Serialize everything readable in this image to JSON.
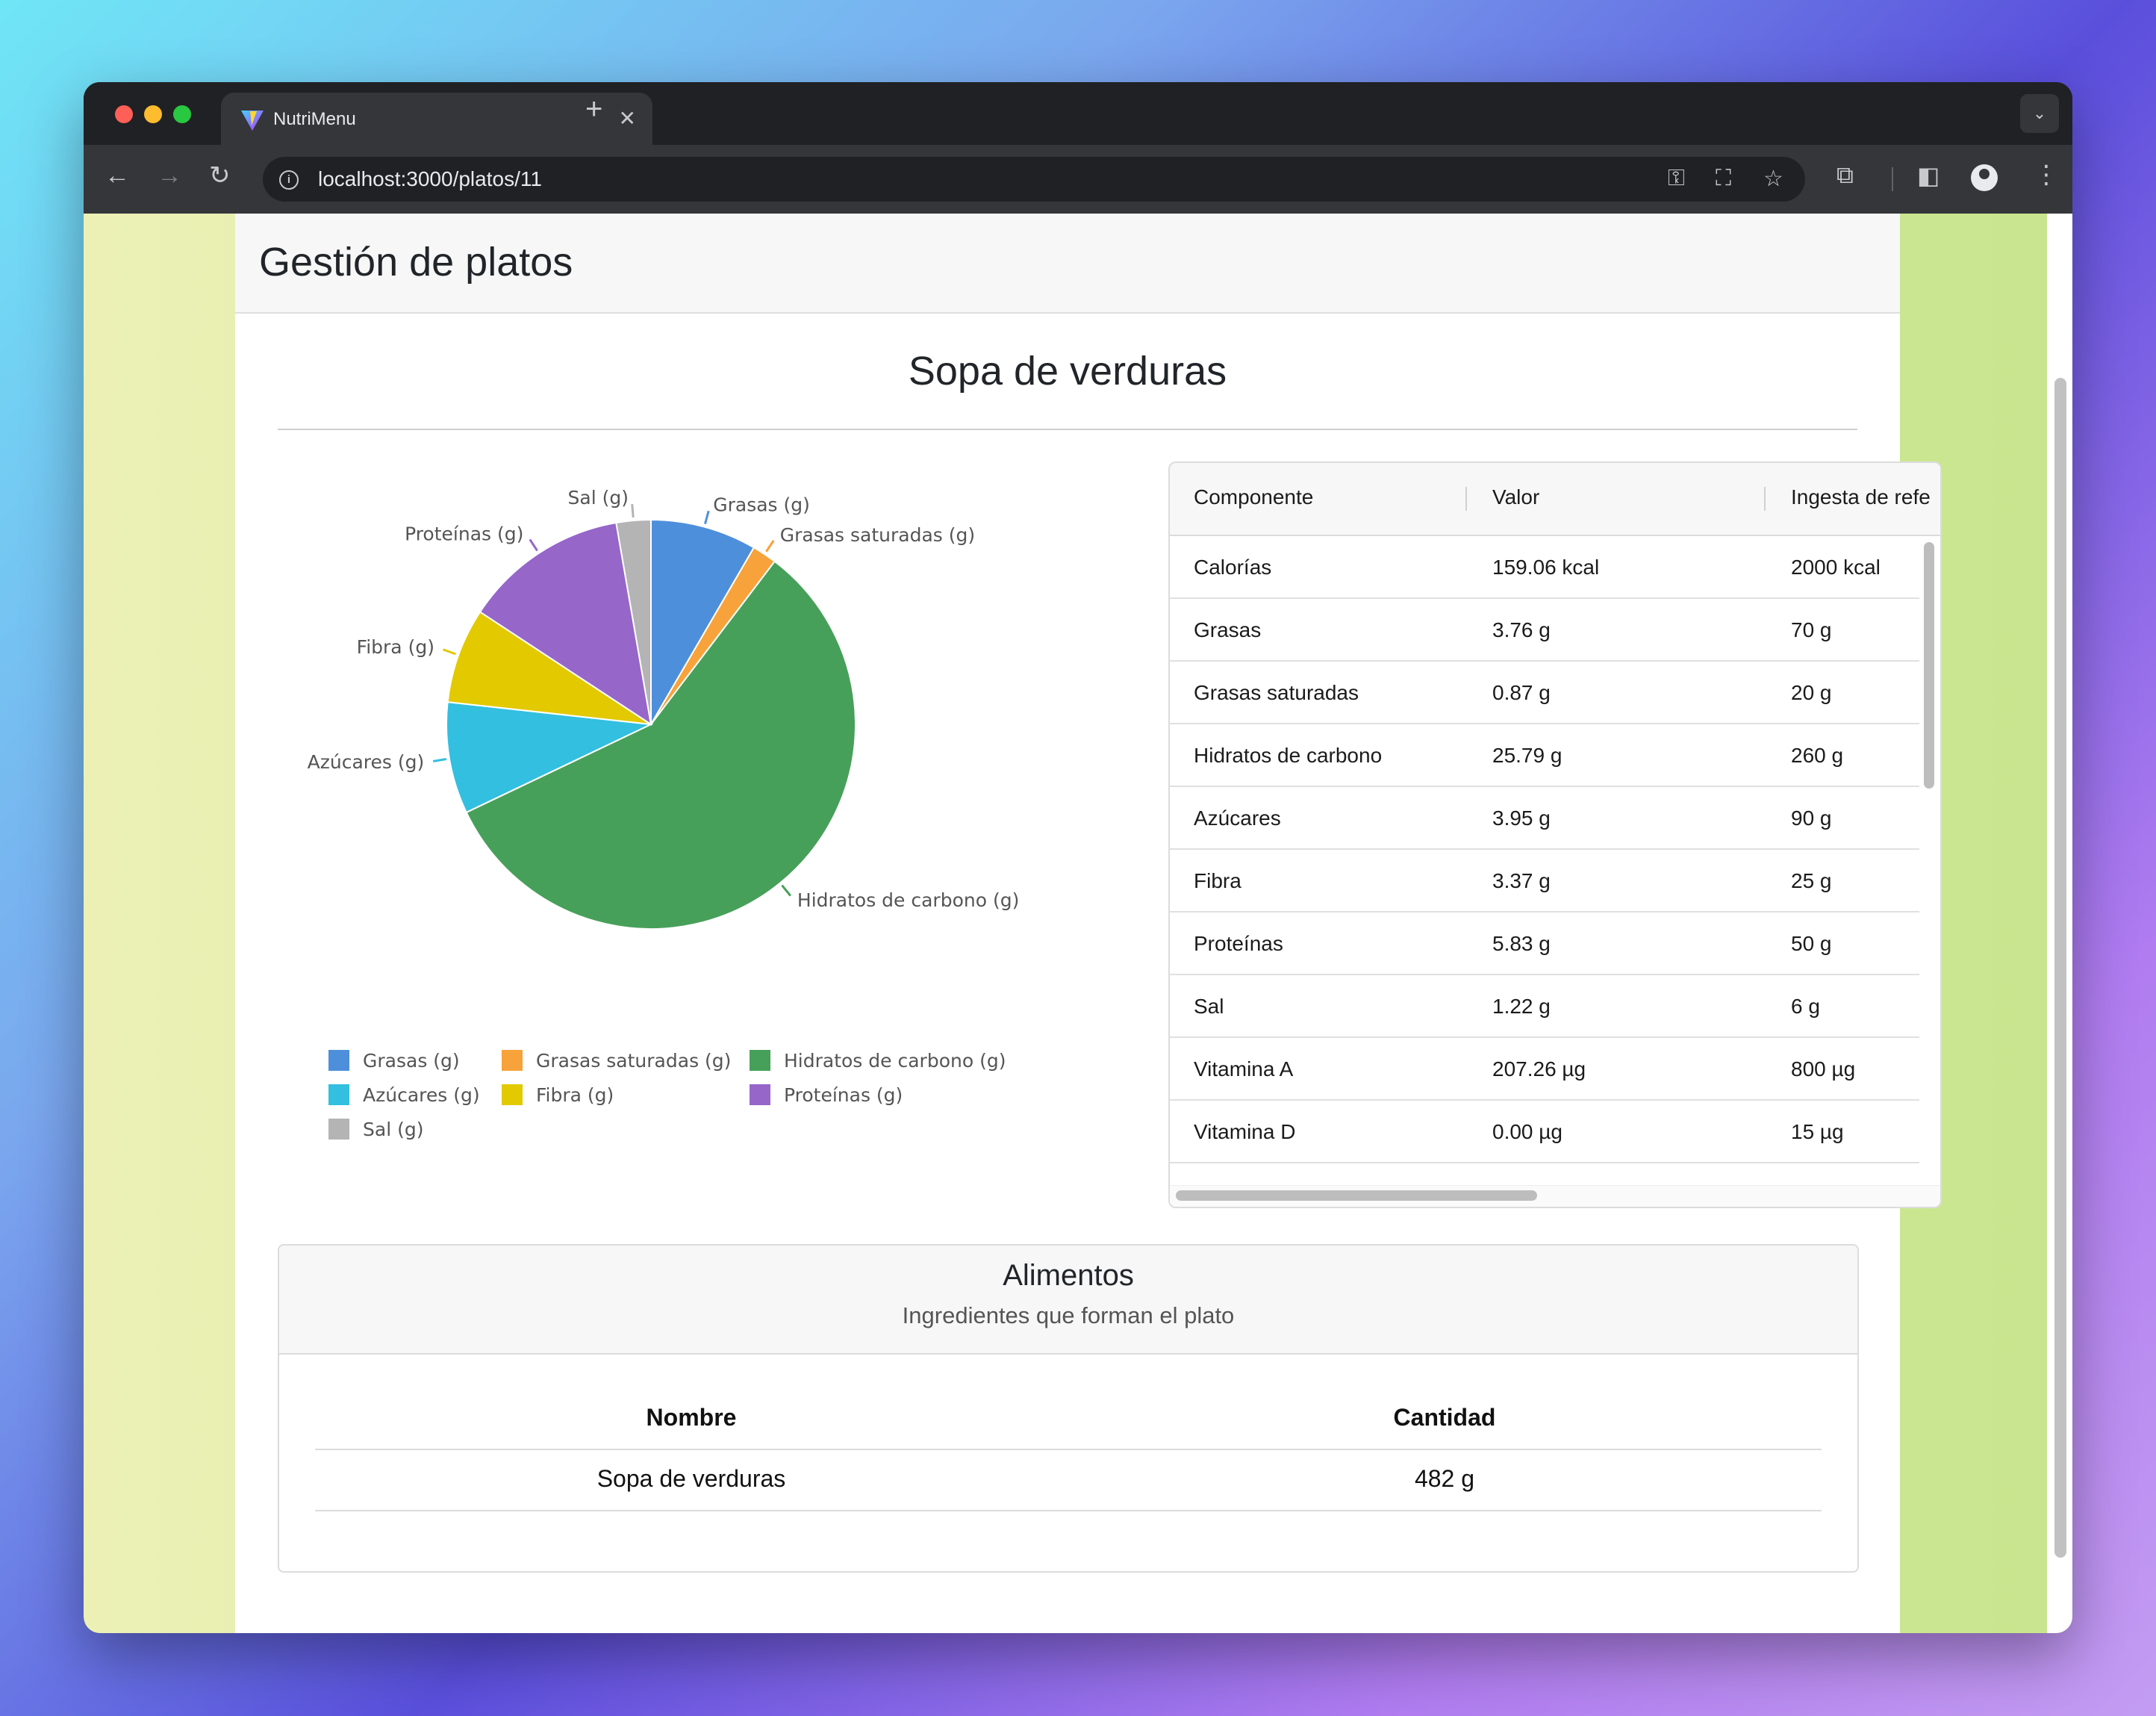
{
  "browser": {
    "tab_title": "NutriMenu",
    "url": "localhost:3000/platos/11",
    "new_tab_symbol": "+",
    "close_tab_symbol": "✕"
  },
  "page": {
    "header_title": "Gestión de platos",
    "dish_name": "Sopa de verduras"
  },
  "chart_data": {
    "type": "pie",
    "labels": [
      "Grasas (g)",
      "Grasas saturadas (g)",
      "Hidratos de carbono (g)",
      "Azúcares (g)",
      "Fibra (g)",
      "Proteínas (g)",
      "Sal (g)"
    ],
    "values": [
      3.76,
      0.87,
      25.79,
      3.95,
      3.37,
      5.83,
      1.22
    ],
    "colors": [
      "#4e8fdc",
      "#f7a23a",
      "#47a05a",
      "#33bfe0",
      "#e2c900",
      "#9666c9",
      "#b4b4b4"
    ],
    "legend_position": "bottom"
  },
  "nutrients": {
    "headers": [
      "Componente",
      "Valor",
      "Ingesta de refe"
    ],
    "rows": [
      {
        "name": "Calorías",
        "value": "159.06 kcal",
        "reference": "2000 kcal"
      },
      {
        "name": "Grasas",
        "value": "3.76 g",
        "reference": "70 g"
      },
      {
        "name": "Grasas saturadas",
        "value": "0.87 g",
        "reference": "20 g"
      },
      {
        "name": "Hidratos de carbono",
        "value": "25.79 g",
        "reference": "260 g"
      },
      {
        "name": "Azúcares",
        "value": "3.95 g",
        "reference": "90 g"
      },
      {
        "name": "Fibra",
        "value": "3.37 g",
        "reference": "25 g"
      },
      {
        "name": "Proteínas",
        "value": "5.83 g",
        "reference": "50 g"
      },
      {
        "name": "Sal",
        "value": "1.22 g",
        "reference": "6 g"
      },
      {
        "name": "Vitamina A",
        "value": "207.26 µg",
        "reference": "800 µg"
      },
      {
        "name": "Vitamina D",
        "value": "0.00 µg",
        "reference": "15 µg"
      }
    ]
  },
  "foods": {
    "title": "Alimentos",
    "subtitle": "Ingredientes que forman el plato",
    "headers": {
      "name": "Nombre",
      "quantity": "Cantidad"
    },
    "rows": [
      {
        "name": "Sopa de verduras",
        "quantity": "482 g"
      }
    ]
  }
}
